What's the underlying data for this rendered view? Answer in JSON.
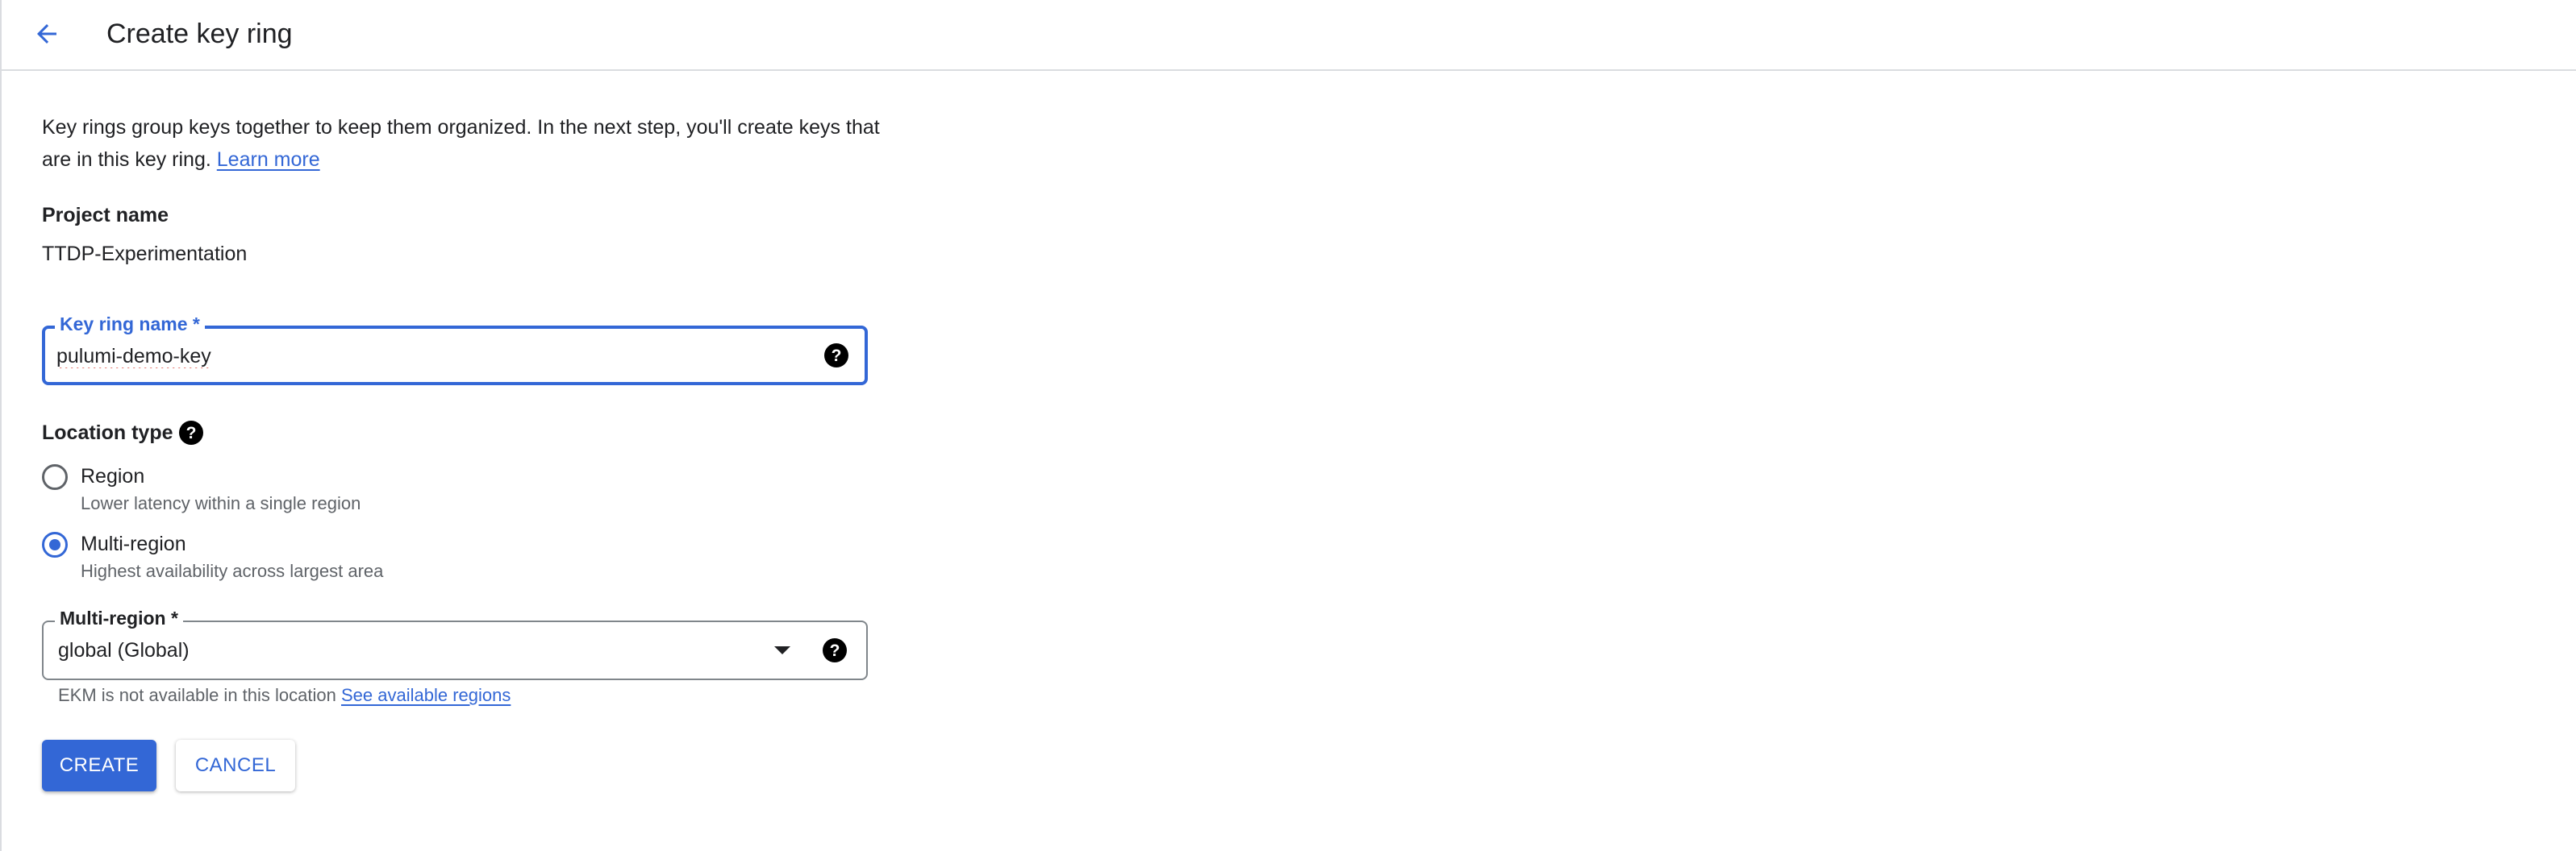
{
  "header": {
    "back_icon": "arrow-back-icon",
    "title": "Create key ring"
  },
  "intro": {
    "text": "Key rings group keys together to keep them organized. In the next step, you'll create keys that are in this key ring.",
    "link_text": "Learn more"
  },
  "project": {
    "label": "Project name",
    "value": "TTDP-Experimentation"
  },
  "key_ring_field": {
    "label": "Key ring name *",
    "value": "pulumi-demo-key",
    "help_icon": "help-circle-icon"
  },
  "location_type": {
    "label": "Location type",
    "help_icon": "help-circle-icon",
    "options": [
      {
        "label": "Region",
        "hint": "Lower latency within a single region",
        "selected": false
      },
      {
        "label": "Multi-region",
        "hint": "Highest availability across largest area",
        "selected": true
      }
    ]
  },
  "multi_region_field": {
    "label": "Multi-region *",
    "value": "global (Global)",
    "dropdown_icon": "arrow-drop-down-icon",
    "help_icon": "help-circle-icon",
    "helper_text": "EKM is not available in this location",
    "helper_link": "See available regions"
  },
  "actions": {
    "create_label": "CREATE",
    "cancel_label": "CANCEL"
  },
  "colors": {
    "accent": "#3367d6",
    "text": "#202124",
    "secondary_text": "#5f6368",
    "divider": "#dadce0"
  }
}
